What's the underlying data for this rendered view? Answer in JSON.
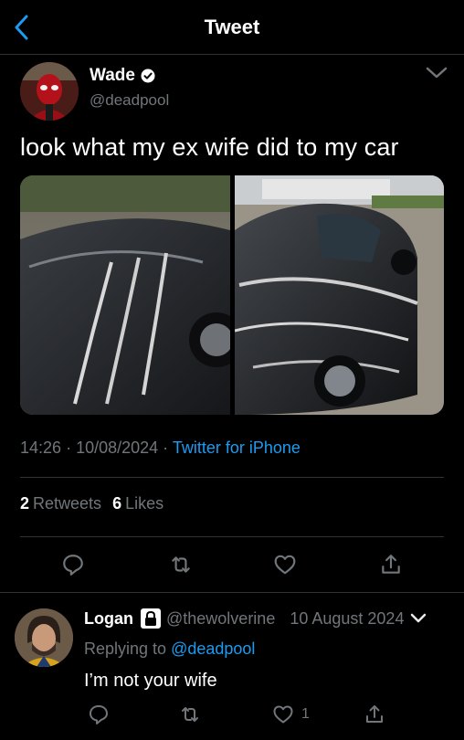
{
  "header": {
    "title": "Tweet"
  },
  "tweet": {
    "author_name": "Wade",
    "author_handle": "@deadpool",
    "text": "look what my ex wife did to my car",
    "time": "14:26",
    "date": "10/08/2024",
    "source": "Twitter for iPhone",
    "retweets_count": "2",
    "retweets_label": "Retweets",
    "likes_count": "6",
    "likes_label": "Likes"
  },
  "reply": {
    "author_name": "Logan",
    "author_handle": "@thewolverine",
    "date": "10 August 2024",
    "replying_prefix": "Replying to",
    "replying_to": "@deadpool",
    "text": "I’m not your wife",
    "like_count": "1"
  },
  "colors": {
    "background": "#000000",
    "text": "#e7e9ea",
    "secondary": "#71767b",
    "accent": "#1d9bf0",
    "divider": "#2f3336"
  },
  "icons": [
    "back-arrow-icon",
    "verified-badge-icon",
    "chevron-down-icon",
    "reply-icon",
    "retweet-icon",
    "like-icon",
    "share-icon",
    "lock-icon"
  ]
}
